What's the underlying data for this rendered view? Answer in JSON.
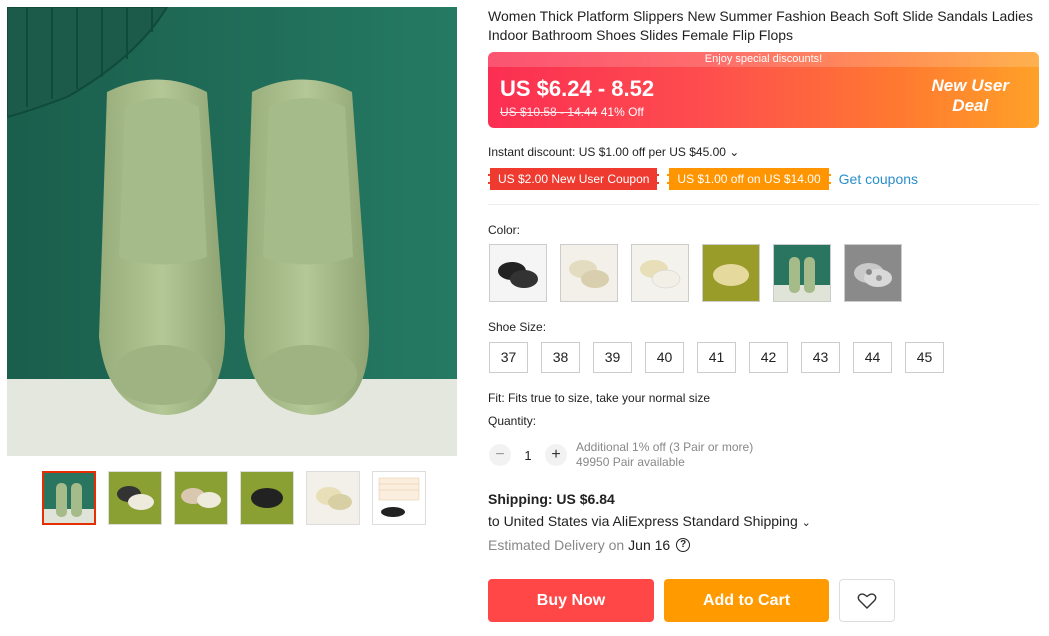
{
  "product": {
    "title": "Women Thick Platform Slippers New Summer Fashion Beach Soft Slide Sandals Ladies Indoor Bathroom Shoes Slides Female Flip Flops"
  },
  "price": {
    "banner_text": "Enjoy special discounts!",
    "range": "US $6.24 - 8.52",
    "original": "US $10.58 - 14.44",
    "discount": "41% Off",
    "new_user_line1": "New User",
    "new_user_line2": "Deal"
  },
  "discounts": {
    "instant": "Instant discount: US $1.00 off per US $45.00",
    "coupon1": "US $2.00 New User Coupon",
    "coupon2": "US $1.00 off on US $14.00",
    "get_coupons": "Get coupons"
  },
  "color": {
    "label": "Color:",
    "options": [
      "black",
      "beige",
      "beige-white",
      "olive",
      "green",
      "grey-camo"
    ]
  },
  "size": {
    "label": "Shoe Size:",
    "options": [
      "37",
      "38",
      "39",
      "40",
      "41",
      "42",
      "43",
      "44",
      "45"
    ]
  },
  "fit": "Fit: Fits true to size, take your normal size",
  "quantity": {
    "label": "Quantity:",
    "minus": "−",
    "value": "1",
    "plus": "+",
    "additional": "Additional 1% off (3 Pair or more)",
    "available": "49950 Pair available"
  },
  "shipping": {
    "title": "Shipping: US $6.84",
    "via": "to United States via AliExpress Standard Shipping",
    "est_label": "Estimated Delivery on",
    "est_date": "Jun 16",
    "help": "?"
  },
  "actions": {
    "buy_now": "Buy Now",
    "add_to_cart": "Add to Cart"
  },
  "colors": {
    "accent_red": "#ff4747",
    "accent_orange": "#ff9a00",
    "link_blue": "#2a8ecd"
  }
}
